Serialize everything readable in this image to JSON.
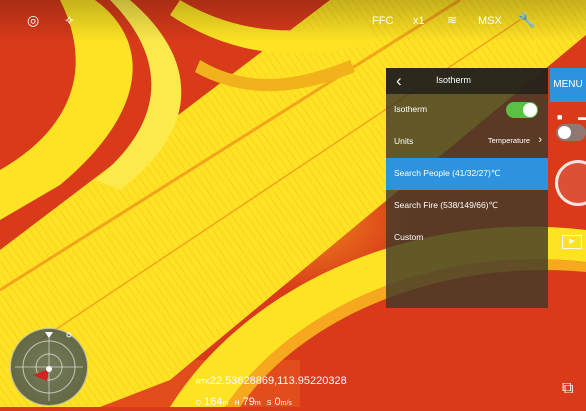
{
  "top_bar": {
    "ffc_label": "FFC",
    "zoom_label": "x1",
    "msx_label": "MSX",
    "icons": [
      "target-icon",
      "compass-icon",
      "palette-icon",
      "wrench-icon"
    ]
  },
  "menu_label": "MENU",
  "panel": {
    "title": "Isotherm",
    "rows": [
      {
        "label": "Isotherm",
        "toggle_on": true
      },
      {
        "label": "Units",
        "value": "Temperature"
      },
      {
        "label": "Search People (41/32/27)℃",
        "selected": true
      },
      {
        "label": "Search Fire (538/149/66)℃"
      },
      {
        "label": "Custom"
      }
    ]
  },
  "telemetry": {
    "rtk_label": "RTK",
    "coordinates": "22.53628869,113.95220328",
    "d_label": "D",
    "d_value": "164",
    "d_unit": "m",
    "h_label": "H",
    "h_value": "79",
    "h_unit": "m",
    "s_label": "S",
    "s_value": "0",
    "s_unit": "m/s"
  },
  "colors": {
    "accent": "#2e93df",
    "toggle_on": "#5cc043",
    "thermal_hot": "#ffe41a",
    "thermal_warm": "#f07a16",
    "thermal_bg": "#d83a1a"
  }
}
